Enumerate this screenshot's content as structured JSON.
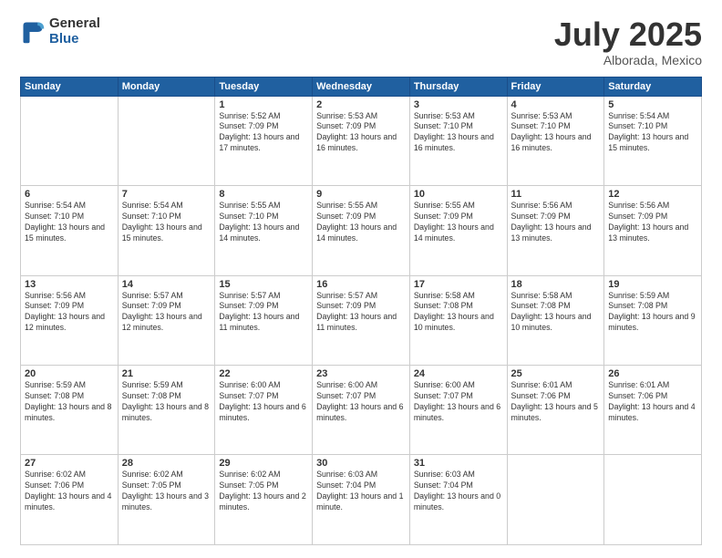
{
  "header": {
    "logo_general": "General",
    "logo_blue": "Blue",
    "title": "July 2025",
    "subtitle": "Alborada, Mexico"
  },
  "days_of_week": [
    "Sunday",
    "Monday",
    "Tuesday",
    "Wednesday",
    "Thursday",
    "Friday",
    "Saturday"
  ],
  "weeks": [
    [
      {
        "day": "",
        "info": ""
      },
      {
        "day": "",
        "info": ""
      },
      {
        "day": "1",
        "info": "Sunrise: 5:52 AM\nSunset: 7:09 PM\nDaylight: 13 hours\nand 17 minutes."
      },
      {
        "day": "2",
        "info": "Sunrise: 5:53 AM\nSunset: 7:09 PM\nDaylight: 13 hours\nand 16 minutes."
      },
      {
        "day": "3",
        "info": "Sunrise: 5:53 AM\nSunset: 7:10 PM\nDaylight: 13 hours\nand 16 minutes."
      },
      {
        "day": "4",
        "info": "Sunrise: 5:53 AM\nSunset: 7:10 PM\nDaylight: 13 hours\nand 16 minutes."
      },
      {
        "day": "5",
        "info": "Sunrise: 5:54 AM\nSunset: 7:10 PM\nDaylight: 13 hours\nand 15 minutes."
      }
    ],
    [
      {
        "day": "6",
        "info": "Sunrise: 5:54 AM\nSunset: 7:10 PM\nDaylight: 13 hours\nand 15 minutes."
      },
      {
        "day": "7",
        "info": "Sunrise: 5:54 AM\nSunset: 7:10 PM\nDaylight: 13 hours\nand 15 minutes."
      },
      {
        "day": "8",
        "info": "Sunrise: 5:55 AM\nSunset: 7:10 PM\nDaylight: 13 hours\nand 14 minutes."
      },
      {
        "day": "9",
        "info": "Sunrise: 5:55 AM\nSunset: 7:09 PM\nDaylight: 13 hours\nand 14 minutes."
      },
      {
        "day": "10",
        "info": "Sunrise: 5:55 AM\nSunset: 7:09 PM\nDaylight: 13 hours\nand 14 minutes."
      },
      {
        "day": "11",
        "info": "Sunrise: 5:56 AM\nSunset: 7:09 PM\nDaylight: 13 hours\nand 13 minutes."
      },
      {
        "day": "12",
        "info": "Sunrise: 5:56 AM\nSunset: 7:09 PM\nDaylight: 13 hours\nand 13 minutes."
      }
    ],
    [
      {
        "day": "13",
        "info": "Sunrise: 5:56 AM\nSunset: 7:09 PM\nDaylight: 13 hours\nand 12 minutes."
      },
      {
        "day": "14",
        "info": "Sunrise: 5:57 AM\nSunset: 7:09 PM\nDaylight: 13 hours\nand 12 minutes."
      },
      {
        "day": "15",
        "info": "Sunrise: 5:57 AM\nSunset: 7:09 PM\nDaylight: 13 hours\nand 11 minutes."
      },
      {
        "day": "16",
        "info": "Sunrise: 5:57 AM\nSunset: 7:09 PM\nDaylight: 13 hours\nand 11 minutes."
      },
      {
        "day": "17",
        "info": "Sunrise: 5:58 AM\nSunset: 7:08 PM\nDaylight: 13 hours\nand 10 minutes."
      },
      {
        "day": "18",
        "info": "Sunrise: 5:58 AM\nSunset: 7:08 PM\nDaylight: 13 hours\nand 10 minutes."
      },
      {
        "day": "19",
        "info": "Sunrise: 5:59 AM\nSunset: 7:08 PM\nDaylight: 13 hours\nand 9 minutes."
      }
    ],
    [
      {
        "day": "20",
        "info": "Sunrise: 5:59 AM\nSunset: 7:08 PM\nDaylight: 13 hours\nand 8 minutes."
      },
      {
        "day": "21",
        "info": "Sunrise: 5:59 AM\nSunset: 7:08 PM\nDaylight: 13 hours\nand 8 minutes."
      },
      {
        "day": "22",
        "info": "Sunrise: 6:00 AM\nSunset: 7:07 PM\nDaylight: 13 hours\nand 6 minutes."
      },
      {
        "day": "23",
        "info": "Sunrise: 6:00 AM\nSunset: 7:07 PM\nDaylight: 13 hours\nand 6 minutes."
      },
      {
        "day": "24",
        "info": "Sunrise: 6:00 AM\nSunset: 7:07 PM\nDaylight: 13 hours\nand 6 minutes."
      },
      {
        "day": "25",
        "info": "Sunrise: 6:01 AM\nSunset: 7:06 PM\nDaylight: 13 hours\nand 5 minutes."
      },
      {
        "day": "26",
        "info": "Sunrise: 6:01 AM\nSunset: 7:06 PM\nDaylight: 13 hours\nand 4 minutes."
      }
    ],
    [
      {
        "day": "27",
        "info": "Sunrise: 6:02 AM\nSunset: 7:06 PM\nDaylight: 13 hours\nand 4 minutes."
      },
      {
        "day": "28",
        "info": "Sunrise: 6:02 AM\nSunset: 7:05 PM\nDaylight: 13 hours\nand 3 minutes."
      },
      {
        "day": "29",
        "info": "Sunrise: 6:02 AM\nSunset: 7:05 PM\nDaylight: 13 hours\nand 2 minutes."
      },
      {
        "day": "30",
        "info": "Sunrise: 6:03 AM\nSunset: 7:04 PM\nDaylight: 13 hours\nand 1 minute."
      },
      {
        "day": "31",
        "info": "Sunrise: 6:03 AM\nSunset: 7:04 PM\nDaylight: 13 hours\nand 0 minutes."
      },
      {
        "day": "",
        "info": ""
      },
      {
        "day": "",
        "info": ""
      }
    ]
  ]
}
